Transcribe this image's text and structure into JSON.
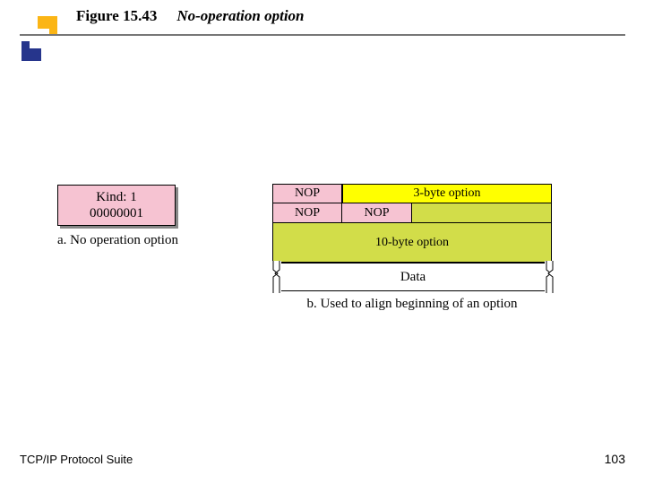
{
  "title": {
    "fignum": "Figure 15.43",
    "text": "No-operation option"
  },
  "partA": {
    "kind_line1": "Kind: 1",
    "kind_line2": "00000001",
    "caption": "a. No operation option"
  },
  "partB": {
    "nop": "NOP",
    "opt3": "3-byte option",
    "opt10": "10-byte option",
    "data": "Data",
    "caption": "b. Used to align beginning of an option"
  },
  "footer": {
    "left": "TCP/IP Protocol Suite",
    "page": "103"
  }
}
